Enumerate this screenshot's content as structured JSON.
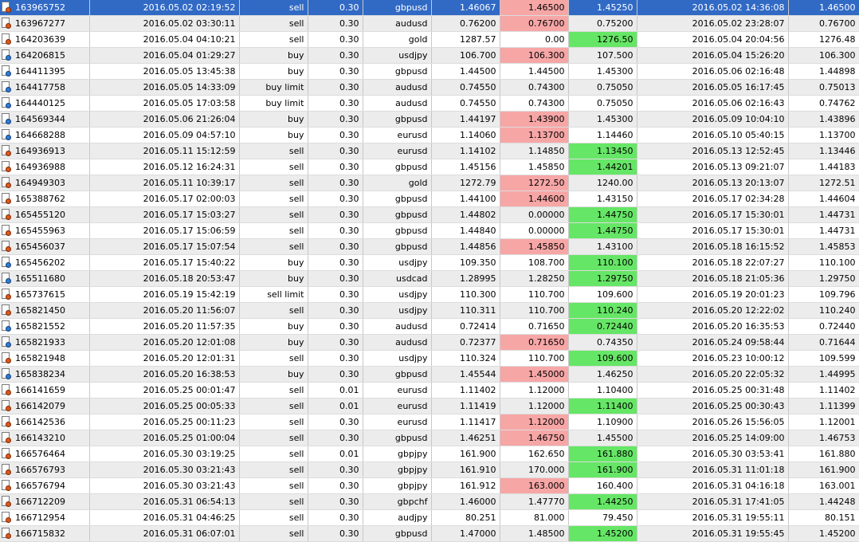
{
  "colors": {
    "selected": "#316ac5",
    "highlight_red": "#f7a6a6",
    "highlight_green": "#66e666",
    "alt_row": "#ececec"
  },
  "icons": {
    "sell": "order-sell-icon",
    "buy": "order-buy-icon"
  },
  "rows": [
    [
      "163965752",
      "2016.05.02 02:19:52",
      "sell",
      "0.30",
      "gbpusd",
      "1.46067",
      "1.46500",
      "1.45250",
      "2016.05.02 14:36:08",
      "1.46500",
      "r",
      ""
    ],
    [
      "163967277",
      "2016.05.02 03:30:11",
      "sell",
      "0.30",
      "audusd",
      "0.76200",
      "0.76700",
      "0.75200",
      "2016.05.02 23:28:07",
      "0.76700",
      "r",
      ""
    ],
    [
      "164203639",
      "2016.05.04 04:10:21",
      "sell",
      "0.30",
      "gold",
      "1287.57",
      "0.00",
      "1276.50",
      "2016.05.04 20:04:56",
      "1276.48",
      "",
      "g"
    ],
    [
      "164206815",
      "2016.05.04 01:29:27",
      "buy",
      "0.30",
      "usdjpy",
      "106.700",
      "106.300",
      "107.500",
      "2016.05.04 15:26:20",
      "106.300",
      "r",
      ""
    ],
    [
      "164411395",
      "2016.05.05 13:45:38",
      "buy",
      "0.30",
      "gbpusd",
      "1.44500",
      "1.44500",
      "1.45300",
      "2016.05.06 02:16:48",
      "1.44898",
      "",
      ""
    ],
    [
      "164417758",
      "2016.05.05 14:33:09",
      "buy limit",
      "0.30",
      "audusd",
      "0.74550",
      "0.74300",
      "0.75050",
      "2016.05.05 16:17:45",
      "0.75013",
      "",
      ""
    ],
    [
      "164440125",
      "2016.05.05 17:03:58",
      "buy limit",
      "0.30",
      "audusd",
      "0.74550",
      "0.74300",
      "0.75050",
      "2016.05.06 02:16:43",
      "0.74762",
      "",
      ""
    ],
    [
      "164569344",
      "2016.05.06 21:26:04",
      "buy",
      "0.30",
      "gbpusd",
      "1.44197",
      "1.43900",
      "1.45300",
      "2016.05.09 10:04:10",
      "1.43896",
      "r",
      ""
    ],
    [
      "164668288",
      "2016.05.09 04:57:10",
      "buy",
      "0.30",
      "eurusd",
      "1.14060",
      "1.13700",
      "1.14460",
      "2016.05.10 05:40:15",
      "1.13700",
      "r",
      ""
    ],
    [
      "164936913",
      "2016.05.11 15:12:59",
      "sell",
      "0.30",
      "eurusd",
      "1.14102",
      "1.14850",
      "1.13450",
      "2016.05.13 12:52:45",
      "1.13446",
      "",
      "g"
    ],
    [
      "164936988",
      "2016.05.12 16:24:31",
      "sell",
      "0.30",
      "gbpusd",
      "1.45156",
      "1.45850",
      "1.44201",
      "2016.05.13 09:21:07",
      "1.44183",
      "",
      "g"
    ],
    [
      "164949303",
      "2016.05.11 10:39:17",
      "sell",
      "0.30",
      "gold",
      "1272.79",
      "1272.50",
      "1240.00",
      "2016.05.13 20:13:07",
      "1272.51",
      "r",
      ""
    ],
    [
      "165388762",
      "2016.05.17 02:00:03",
      "sell",
      "0.30",
      "gbpusd",
      "1.44100",
      "1.44600",
      "1.43150",
      "2016.05.17 02:34:28",
      "1.44604",
      "r",
      ""
    ],
    [
      "165455120",
      "2016.05.17 15:03:27",
      "sell",
      "0.30",
      "gbpusd",
      "1.44802",
      "0.00000",
      "1.44750",
      "2016.05.17 15:30:01",
      "1.44731",
      "",
      "g"
    ],
    [
      "165455963",
      "2016.05.17 15:06:59",
      "sell",
      "0.30",
      "gbpusd",
      "1.44840",
      "0.00000",
      "1.44750",
      "2016.05.17 15:30:01",
      "1.44731",
      "",
      "g"
    ],
    [
      "165456037",
      "2016.05.17 15:07:54",
      "sell",
      "0.30",
      "gbpusd",
      "1.44856",
      "1.45850",
      "1.43100",
      "2016.05.18 16:15:52",
      "1.45853",
      "r",
      ""
    ],
    [
      "165456202",
      "2016.05.17 15:40:22",
      "buy",
      "0.30",
      "usdjpy",
      "109.350",
      "108.700",
      "110.100",
      "2016.05.18 22:07:27",
      "110.100",
      "",
      "g"
    ],
    [
      "165511680",
      "2016.05.18 20:53:47",
      "buy",
      "0.30",
      "usdcad",
      "1.28995",
      "1.28250",
      "1.29750",
      "2016.05.18 21:05:36",
      "1.29750",
      "",
      "g"
    ],
    [
      "165737615",
      "2016.05.19 15:42:19",
      "sell limit",
      "0.30",
      "usdjpy",
      "110.300",
      "110.700",
      "109.600",
      "2016.05.19 20:01:23",
      "109.796",
      "",
      ""
    ],
    [
      "165821450",
      "2016.05.20 11:56:07",
      "sell",
      "0.30",
      "usdjpy",
      "110.311",
      "110.700",
      "110.240",
      "2016.05.20 12:22:02",
      "110.240",
      "",
      "g"
    ],
    [
      "165821552",
      "2016.05.20 11:57:35",
      "buy",
      "0.30",
      "audusd",
      "0.72414",
      "0.71650",
      "0.72440",
      "2016.05.20 16:35:53",
      "0.72440",
      "",
      "g"
    ],
    [
      "165821933",
      "2016.05.20 12:01:08",
      "buy",
      "0.30",
      "audusd",
      "0.72377",
      "0.71650",
      "0.74350",
      "2016.05.24 09:58:44",
      "0.71644",
      "r",
      ""
    ],
    [
      "165821948",
      "2016.05.20 12:01:31",
      "sell",
      "0.30",
      "usdjpy",
      "110.324",
      "110.700",
      "109.600",
      "2016.05.23 10:00:12",
      "109.599",
      "",
      "g"
    ],
    [
      "165838234",
      "2016.05.20 16:38:53",
      "buy",
      "0.30",
      "gbpusd",
      "1.45544",
      "1.45000",
      "1.46250",
      "2016.05.20 22:05:32",
      "1.44995",
      "r",
      ""
    ],
    [
      "166141659",
      "2016.05.25 00:01:47",
      "sell",
      "0.01",
      "eurusd",
      "1.11402",
      "1.12000",
      "1.10400",
      "2016.05.25 00:31:48",
      "1.11402",
      "",
      ""
    ],
    [
      "166142079",
      "2016.05.25 00:05:33",
      "sell",
      "0.01",
      "eurusd",
      "1.11419",
      "1.12000",
      "1.11400",
      "2016.05.25 00:30:43",
      "1.11399",
      "",
      "g"
    ],
    [
      "166142536",
      "2016.05.25 00:11:23",
      "sell",
      "0.30",
      "eurusd",
      "1.11417",
      "1.12000",
      "1.10900",
      "2016.05.26 15:56:05",
      "1.12001",
      "r",
      ""
    ],
    [
      "166143210",
      "2016.05.25 01:00:04",
      "sell",
      "0.30",
      "gbpusd",
      "1.46251",
      "1.46750",
      "1.45500",
      "2016.05.25 14:09:00",
      "1.46753",
      "r",
      ""
    ],
    [
      "166576464",
      "2016.05.30 03:19:25",
      "sell",
      "0.01",
      "gbpjpy",
      "161.900",
      "162.650",
      "161.880",
      "2016.05.30 03:53:41",
      "161.880",
      "",
      "g"
    ],
    [
      "166576793",
      "2016.05.30 03:21:43",
      "sell",
      "0.30",
      "gbpjpy",
      "161.910",
      "170.000",
      "161.900",
      "2016.05.31 11:01:18",
      "161.900",
      "",
      "g"
    ],
    [
      "166576794",
      "2016.05.30 03:21:43",
      "sell",
      "0.30",
      "gbpjpy",
      "161.912",
      "163.000",
      "160.400",
      "2016.05.31 04:16:18",
      "163.001",
      "r",
      ""
    ],
    [
      "166712209",
      "2016.05.31 06:54:13",
      "sell",
      "0.30",
      "gbpchf",
      "1.46000",
      "1.47770",
      "1.44250",
      "2016.05.31 17:41:05",
      "1.44248",
      "",
      "g"
    ],
    [
      "166712954",
      "2016.05.31 04:46:25",
      "sell",
      "0.30",
      "audjpy",
      "80.251",
      "81.000",
      "79.450",
      "2016.05.31 19:55:11",
      "80.151",
      "",
      ""
    ],
    [
      "166715832",
      "2016.05.31 06:07:01",
      "sell",
      "0.30",
      "gbpusd",
      "1.47000",
      "1.48500",
      "1.45200",
      "2016.05.31 19:55:45",
      "1.45200",
      "",
      "g"
    ]
  ]
}
